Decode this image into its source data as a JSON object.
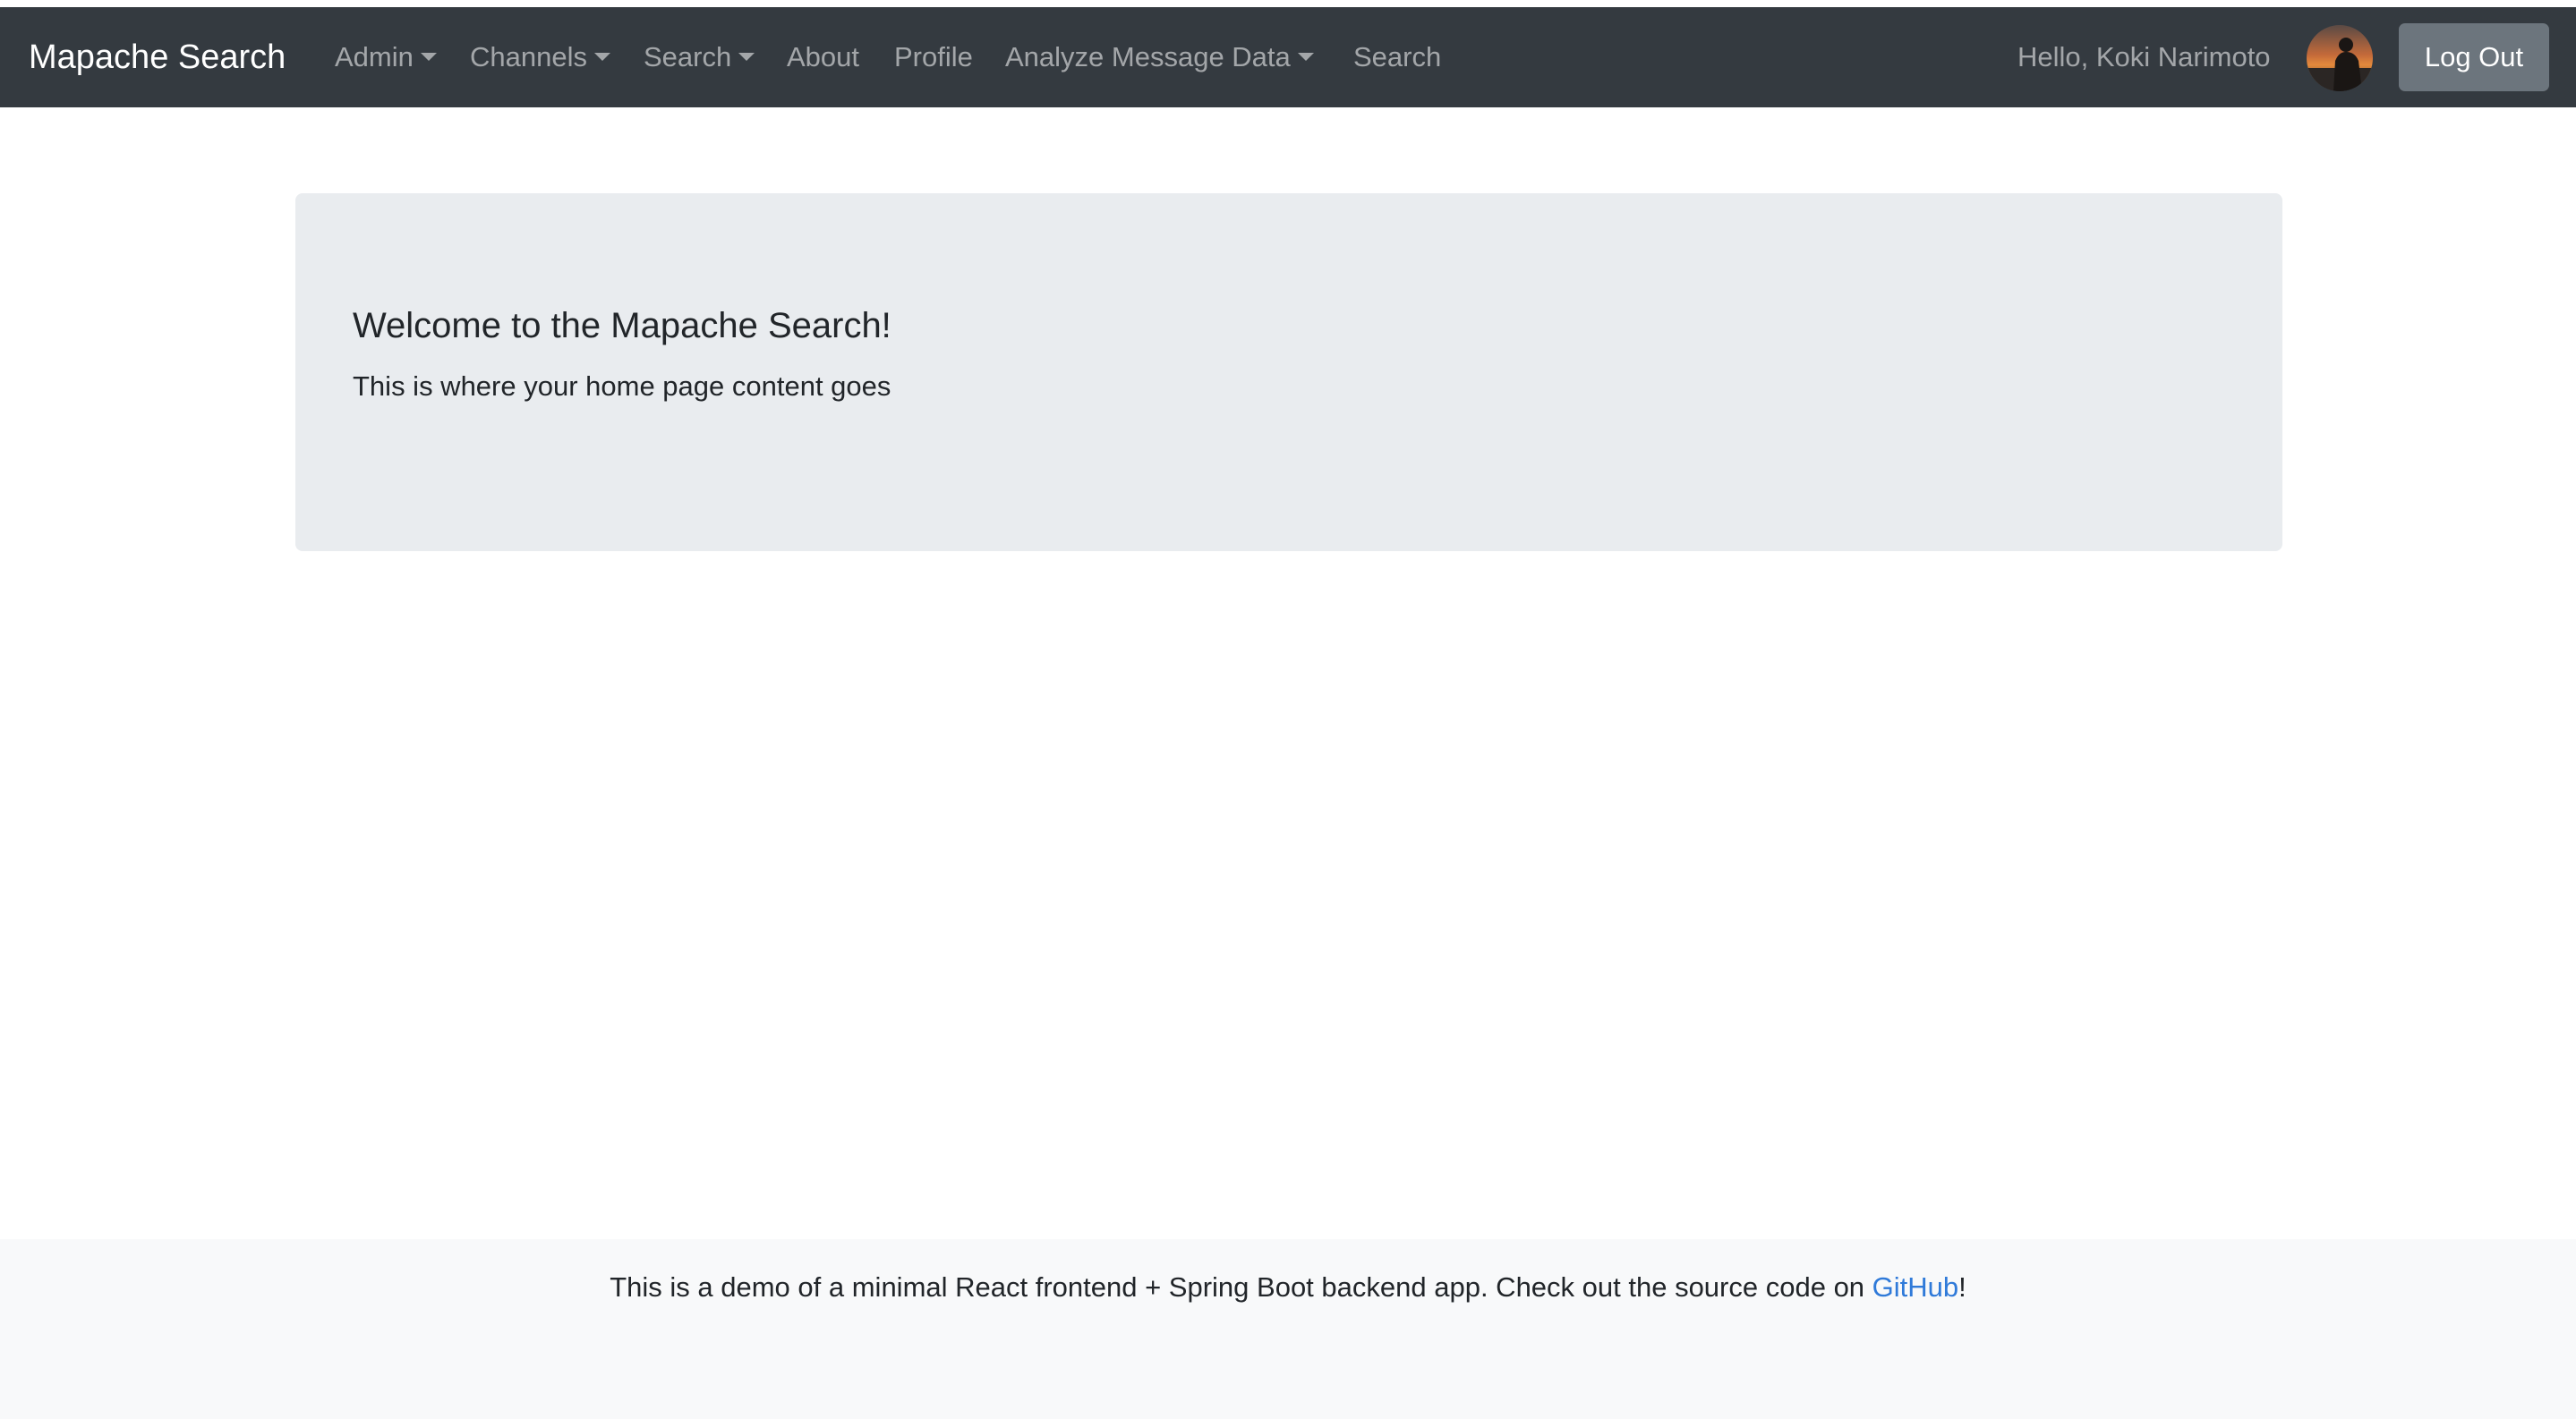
{
  "navbar": {
    "brand": "Mapache Search",
    "items": [
      {
        "label": "Admin",
        "dropdown": true
      },
      {
        "label": "Channels",
        "dropdown": true
      },
      {
        "label": "Search",
        "dropdown": true
      },
      {
        "label": "About",
        "dropdown": false
      },
      {
        "label": "Profile",
        "dropdown": false
      },
      {
        "label": "Analyze Message Data",
        "dropdown": true
      },
      {
        "label": "Search",
        "dropdown": false
      }
    ],
    "greeting": "Hello, Koki Narimoto",
    "logout_label": "Log Out"
  },
  "jumbotron": {
    "title": "Welcome to the Mapache Search!",
    "text": "This is where your home page content goes"
  },
  "footer": {
    "text_before": "This is a demo of a minimal React frontend + Spring Boot backend app. Check out the source code on ",
    "link_label": "GitHub",
    "text_after": "!"
  },
  "colors": {
    "navbar_bg": "#343a40",
    "button_secondary": "#6c757d",
    "jumbotron_bg": "#e9ecef",
    "footer_bg": "#f8f9fa",
    "link": "#2f7ad9"
  }
}
